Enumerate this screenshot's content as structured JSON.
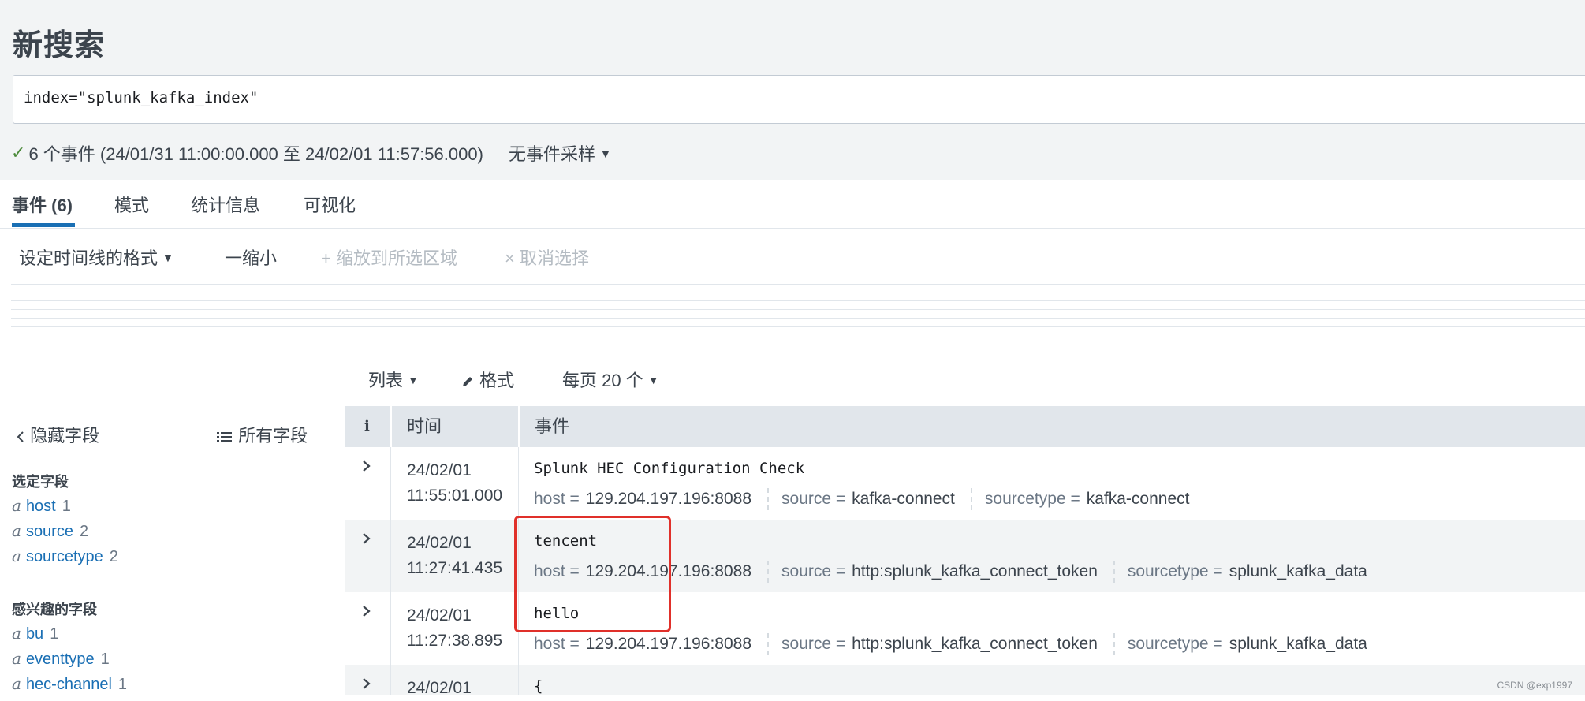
{
  "page": {
    "title": "新搜索"
  },
  "search": {
    "query": "index=\"splunk_kafka_index\""
  },
  "status": {
    "check_glyph": "✓",
    "summary": "6 个事件 (24/01/31 11:00:00.000 至 24/02/01 11:57:56.000)",
    "sampling": "无事件采样",
    "caret": "▼"
  },
  "tabs": [
    {
      "label": "事件 (6)"
    },
    {
      "label": "模式"
    },
    {
      "label": "统计信息"
    },
    {
      "label": "可视化"
    }
  ],
  "timeline_toolbar": {
    "format_label": "设定时间线的格式",
    "zoom_out": "一缩小",
    "zoom_to_selection": "+ 缩放到所选区域",
    "deselect": "× 取消选择"
  },
  "results_toolbar": {
    "list_label": "列表",
    "format_label": "格式",
    "per_page_label": "每页 20 个"
  },
  "sidebar": {
    "hide_fields": "隐藏字段",
    "all_fields": "所有字段",
    "selected_heading": "选定字段",
    "selected_fields": [
      {
        "type": "a",
        "name": "host",
        "count": "1"
      },
      {
        "type": "a",
        "name": "source",
        "count": "2"
      },
      {
        "type": "a",
        "name": "sourcetype",
        "count": "2"
      }
    ],
    "interesting_heading": "感兴趣的字段",
    "interesting_fields": [
      {
        "type": "a",
        "name": "bu",
        "count": "1"
      },
      {
        "type": "a",
        "name": "eventtype",
        "count": "1"
      },
      {
        "type": "a",
        "name": "hec-channel",
        "count": "1"
      }
    ]
  },
  "table": {
    "headers": {
      "info": "i",
      "time": "时间",
      "event": "事件"
    },
    "rows": [
      {
        "date": "24/02/01",
        "time": "11:55:01.000",
        "raw": "Splunk HEC Configuration Check",
        "host_key": "host =",
        "host": "129.204.197.196:8088",
        "source_key": "source =",
        "source": "kafka-connect",
        "sourcetype_key": "sourcetype =",
        "sourcetype": "kafka-connect"
      },
      {
        "date": "24/02/01",
        "time": "11:27:41.435",
        "raw": "tencent",
        "host_key": "host =",
        "host": "129.204.197.196:8088",
        "source_key": "source =",
        "source": "http:splunk_kafka_connect_token",
        "sourcetype_key": "sourcetype =",
        "sourcetype": "splunk_kafka_data"
      },
      {
        "date": "24/02/01",
        "time": "11:27:38.895",
        "raw": "hello",
        "host_key": "host =",
        "host": "129.204.197.196:8088",
        "source_key": "source =",
        "source": "http:splunk_kafka_connect_token",
        "sourcetype_key": "sourcetype =",
        "sourcetype": "splunk_kafka_data"
      },
      {
        "date": "24/02/01",
        "raw": "{"
      }
    ]
  },
  "watermark": "CSDN @exp1997",
  "colors": {
    "accent": "#1a6fb4",
    "check": "#4b8a3a",
    "highlight": "#e0302a"
  }
}
